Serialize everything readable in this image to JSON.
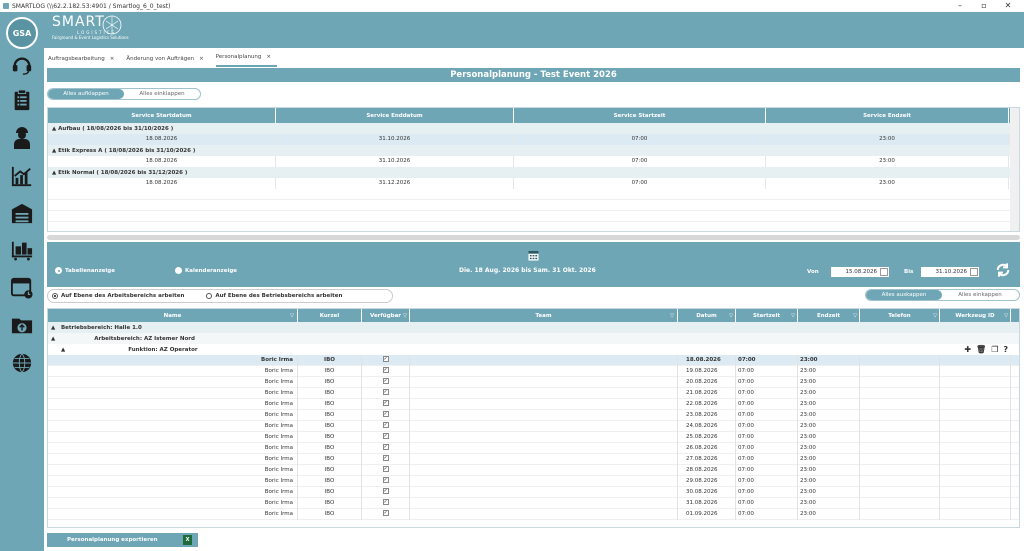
{
  "window": {
    "title": "SMARTLOG (\\\\62.2.182.53:4901 / Smartlog_6_0_test)"
  },
  "sidebar": {
    "logo": "GSA",
    "icons": [
      "headset-icon",
      "clipboard-icon",
      "worker-icon",
      "chart-icon",
      "warehouse-icon",
      "forklift-icon",
      "calendar-window-icon",
      "folder-upload-icon",
      "globe-network-icon"
    ]
  },
  "brand": {
    "name": "SMART",
    "sub": "LOGISTICS",
    "tagline": "Fairground & Event Logistics Solutions"
  },
  "tabs": [
    {
      "label": "Auftragsbearbeitung"
    },
    {
      "label": "Änderung von Aufträgen"
    },
    {
      "label": "Personalplanung"
    }
  ],
  "page_title": "Personalplanung - Test Event 2026",
  "top_toggle": {
    "expand": "Alles aufklappen",
    "collapse": "Alles einklappen"
  },
  "top_grid": {
    "headers": [
      "Service Startdatum",
      "Service Enddatum",
      "Service Startzeit",
      "Service Endzeit"
    ],
    "groups": [
      {
        "label": "Aufbau ( 18/08/2026 bis 31/10/2026 )",
        "row": [
          "18.08.2026",
          "31.10.2026",
          "07:00",
          "23:00"
        ]
      },
      {
        "label": "Etik Express A ( 18/08/2026 bis 31/10/2026 )",
        "row": [
          "18.08.2026",
          "31.10.2026",
          "07:00",
          "23:00"
        ]
      },
      {
        "label": "Etik Normal ( 18/08/2026 bis 31/12/2026 )",
        "row": [
          "18.08.2026",
          "31.12.2026",
          "07:00",
          "23:00"
        ]
      }
    ]
  },
  "view": {
    "table": "Tabellenanzeige",
    "calendar": "Kalenderanzeige",
    "range": "Die. 18 Aug. 2026  bis  Sam. 31 Okt. 2026",
    "from_label": "Von",
    "from": "15.08.2026",
    "to_label": "Bis",
    "to": "31.10.2026"
  },
  "level": {
    "opt1": "Auf Ebene des Arbeitsbereichs arbeiten",
    "opt2": "Auf Ebene des Betriebsbereichs arbeiten"
  },
  "bottom_toggle": {
    "expand": "Alles auskappen",
    "collapse": "Alles einkappen"
  },
  "bottom_grid": {
    "headers": [
      "Name",
      "Kurzel",
      "Verfügbar",
      "Team",
      "Datum",
      "Startzeit",
      "Endzeit",
      "Telefon",
      "Werkzeug ID"
    ],
    "group1": "Betriebsbereich: Halle 1.0",
    "group2": "Arbeitsbereich: AZ Istemer Nord",
    "group3": "Funktion: AZ Operator",
    "rows": [
      {
        "name": "Boric Irma",
        "kurzel": "IBO",
        "datum": "18.08.2026",
        "start": "07:00",
        "end": "23:00"
      },
      {
        "name": "Boric Irma",
        "kurzel": "IBO",
        "datum": "19.08.2026",
        "start": "07:00",
        "end": "23:00"
      },
      {
        "name": "Boric Irma",
        "kurzel": "IBO",
        "datum": "20.08.2026",
        "start": "07:00",
        "end": "23:00"
      },
      {
        "name": "Boric Irma",
        "kurzel": "IBO",
        "datum": "21.08.2026",
        "start": "07:00",
        "end": "23:00"
      },
      {
        "name": "Boric Irma",
        "kurzel": "IBO",
        "datum": "22.08.2026",
        "start": "07:00",
        "end": "23:00"
      },
      {
        "name": "Boric Irma",
        "kurzel": "IBO",
        "datum": "23.08.2026",
        "start": "07:00",
        "end": "23:00"
      },
      {
        "name": "Boric Irma",
        "kurzel": "IBO",
        "datum": "24.08.2026",
        "start": "07:00",
        "end": "23:00"
      },
      {
        "name": "Boric Irma",
        "kurzel": "IBO",
        "datum": "25.08.2026",
        "start": "07:00",
        "end": "23:00"
      },
      {
        "name": "Boric Irma",
        "kurzel": "IBO",
        "datum": "26.08.2026",
        "start": "07:00",
        "end": "23:00"
      },
      {
        "name": "Boric Irma",
        "kurzel": "IBO",
        "datum": "27.08.2026",
        "start": "07:00",
        "end": "23:00"
      },
      {
        "name": "Boric Irma",
        "kurzel": "IBO",
        "datum": "28.08.2026",
        "start": "07:00",
        "end": "23:00"
      },
      {
        "name": "Boric Irma",
        "kurzel": "IBO",
        "datum": "29.08.2026",
        "start": "07:00",
        "end": "23:00"
      },
      {
        "name": "Boric Irma",
        "kurzel": "IBO",
        "datum": "30.08.2026",
        "start": "07:00",
        "end": "23:00"
      },
      {
        "name": "Boric Irma",
        "kurzel": "IBO",
        "datum": "31.08.2026",
        "start": "07:00",
        "end": "23:00"
      },
      {
        "name": "Boric Irma",
        "kurzel": "IBO",
        "datum": "01.09.2026",
        "start": "07:00",
        "end": "23:00"
      }
    ]
  },
  "export_label": "Personalplanung exportieren",
  "colors": {
    "accent": "#6fa6b5",
    "selected_row": "#dbeaf3"
  }
}
